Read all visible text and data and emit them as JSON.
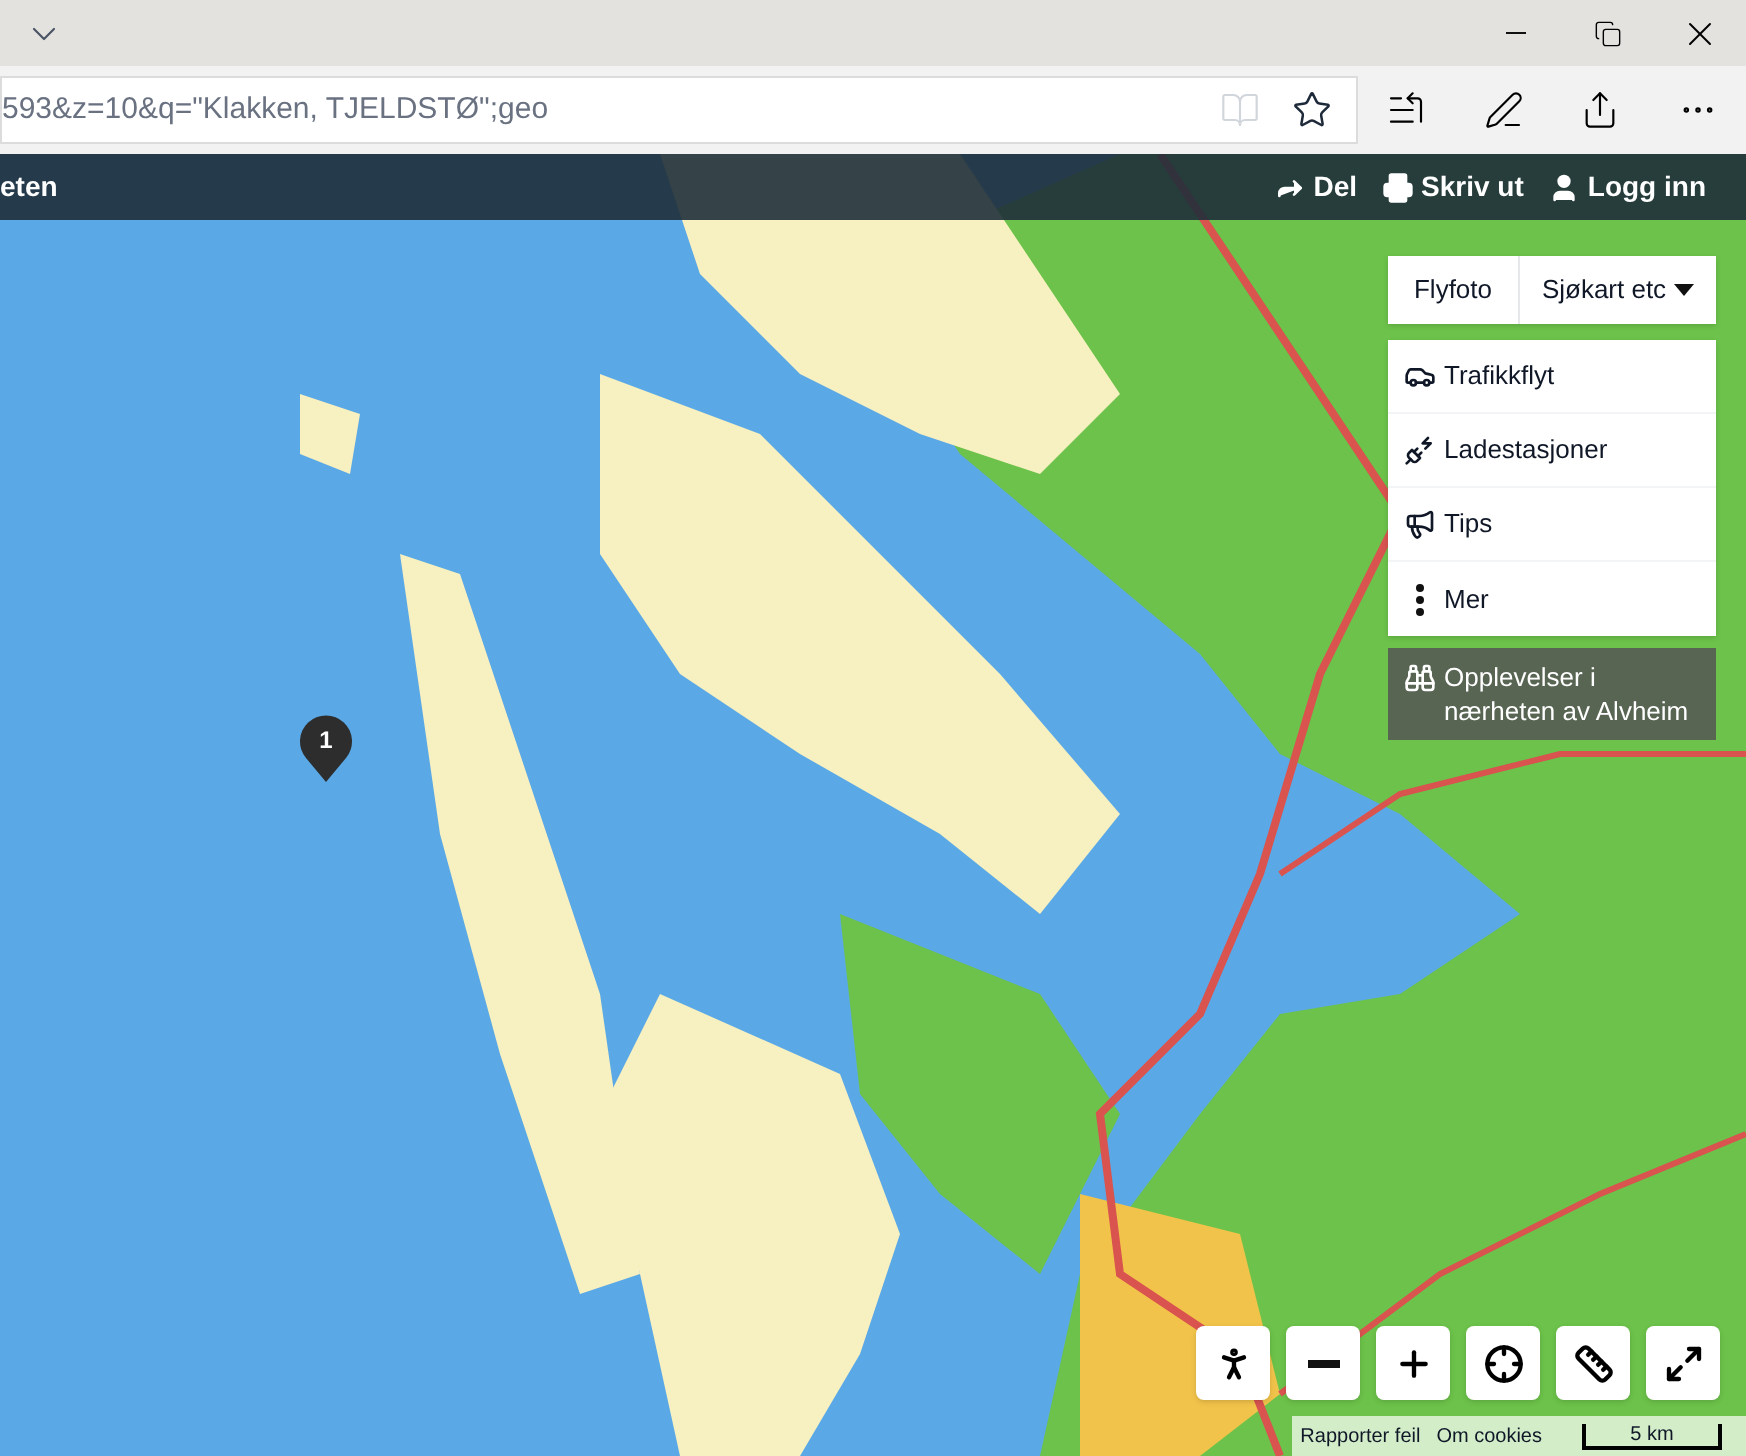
{
  "browser": {
    "address": "593&z=10&q=\"Klakken, TJELDSTØ\";geo"
  },
  "app_bar": {
    "title": "eten",
    "actions": [
      {
        "label": "Del",
        "kind": "share"
      },
      {
        "label": "Skriv ut",
        "kind": "print"
      },
      {
        "label": "Logg inn",
        "kind": "user"
      }
    ]
  },
  "layer_buttons": [
    {
      "label": "Flyfoto",
      "kind": "plain"
    },
    {
      "label": "Sjøkart etc",
      "kind": "dropdown"
    }
  ],
  "menu": [
    {
      "label": "Trafikkflyt",
      "kind": "traffic"
    },
    {
      "label": "Ladestasjoner",
      "kind": "charging"
    },
    {
      "label": "Tips",
      "kind": "tips"
    },
    {
      "label": "Mer",
      "kind": "more"
    }
  ],
  "nearby": "Opplevelser i nærheten av Alvheim",
  "marker": "1",
  "controls": [
    {
      "kind": "person"
    },
    {
      "kind": "zoom-out"
    },
    {
      "kind": "zoom-in"
    },
    {
      "kind": "locate"
    },
    {
      "kind": "measure"
    },
    {
      "kind": "fullscreen"
    }
  ],
  "footer_links": [
    "Rapporter feil",
    "Om cookies"
  ],
  "scale": "5 km"
}
